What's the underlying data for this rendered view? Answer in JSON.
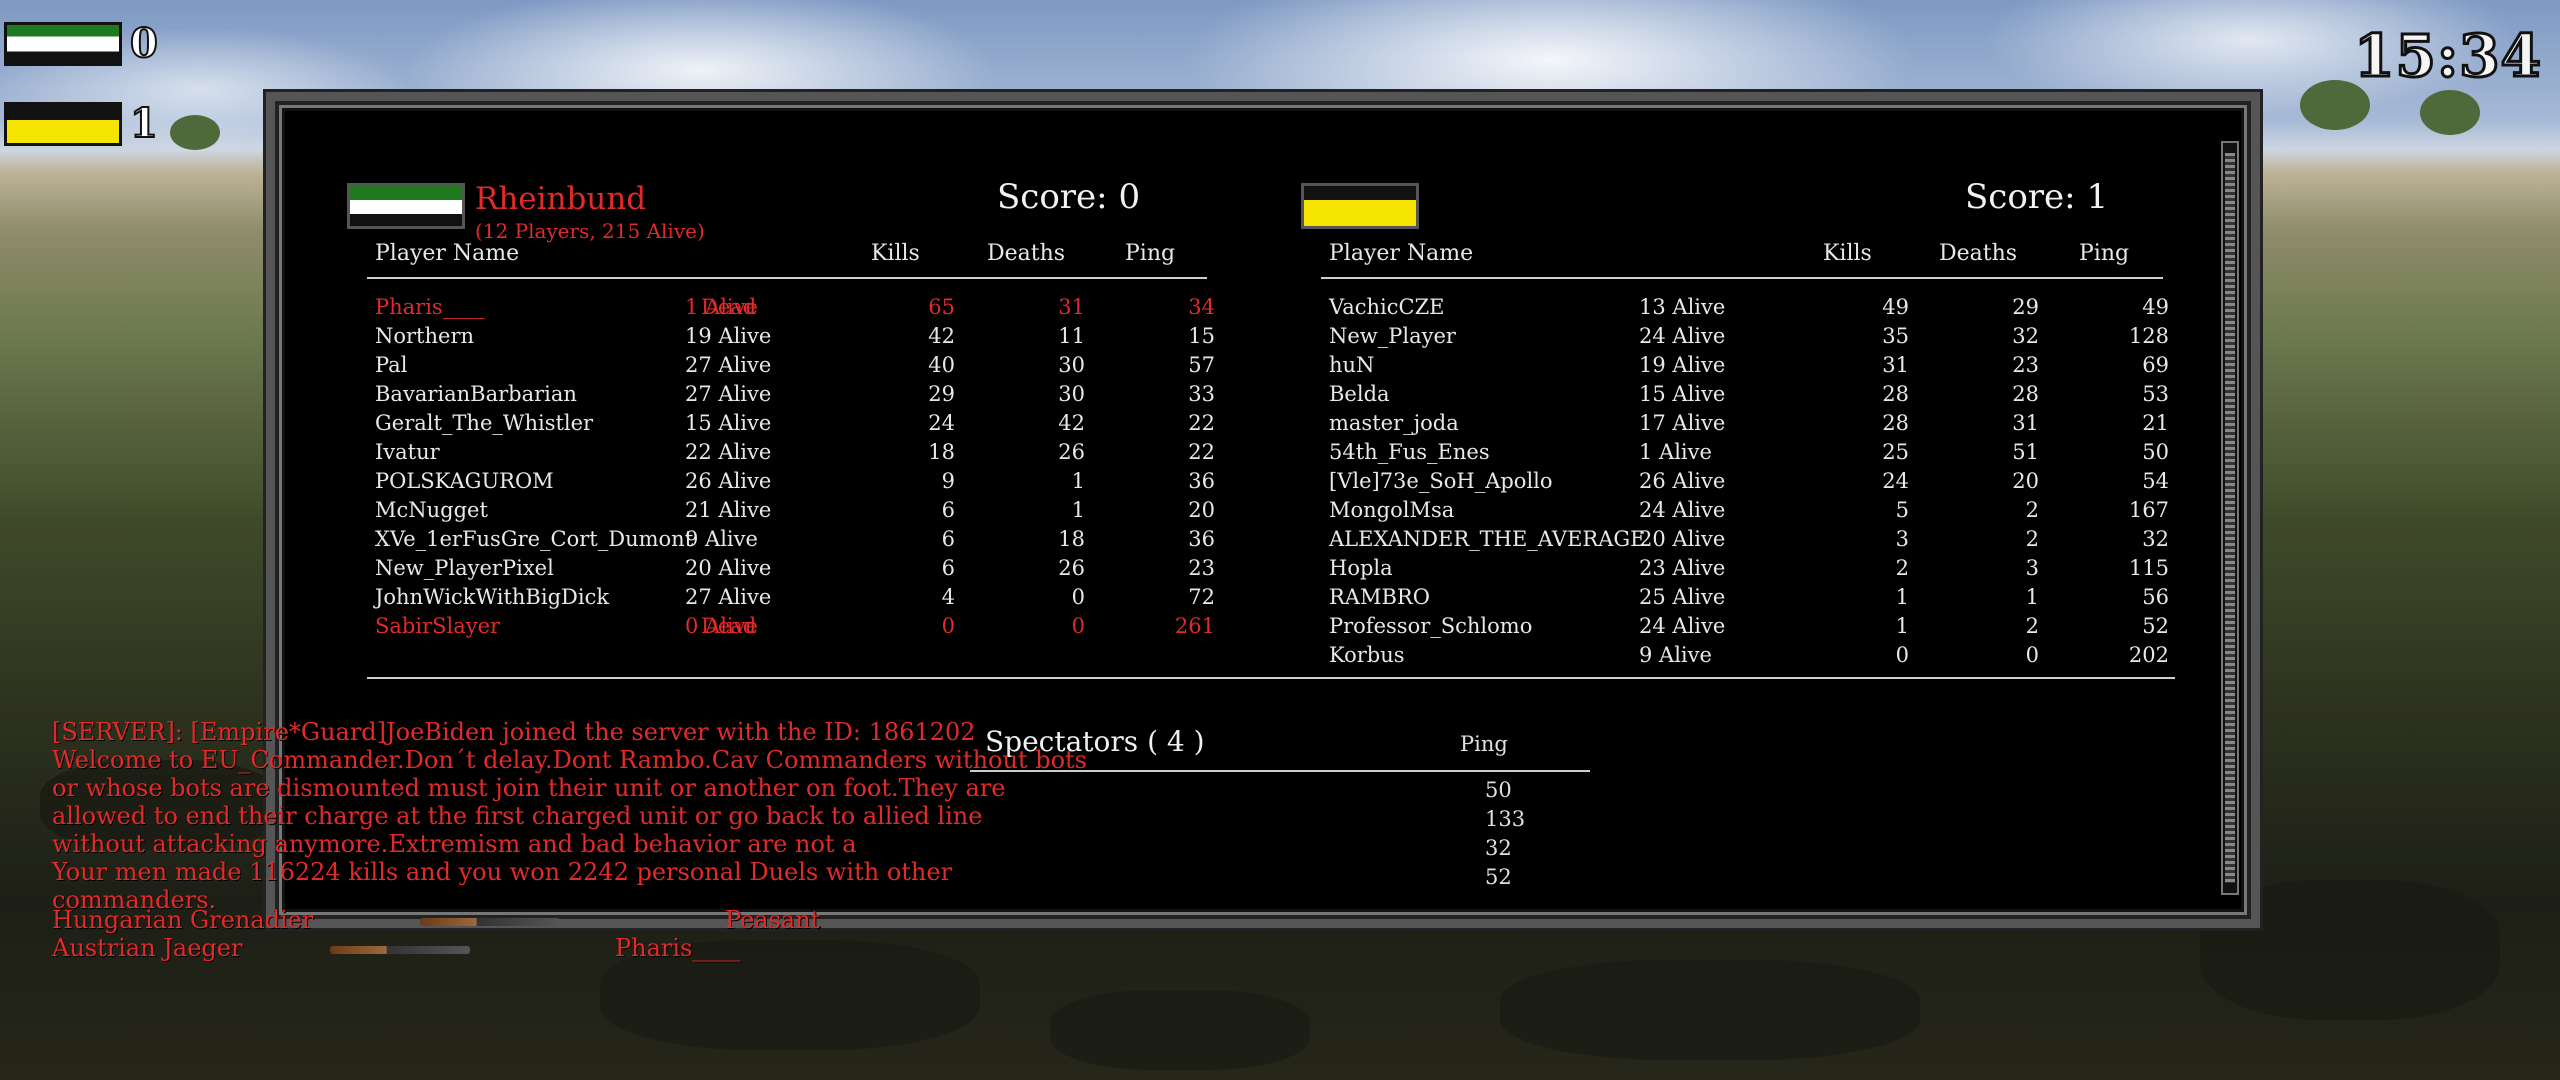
{
  "hud": {
    "team1_score": "0",
    "team2_score": "1",
    "clock": "15:34"
  },
  "colors": {
    "red_text": "#e12b2b",
    "team1_flag": [
      "#1f7a1f",
      "#ffffff",
      "#111111"
    ],
    "team2_flag": [
      "#111111",
      "#f5e400"
    ]
  },
  "left_team": {
    "name": "Rheinbund",
    "subtitle": "(12 Players,  215 Alive)",
    "score_label": "Score: 0",
    "headers": {
      "name": "Player Name",
      "kills": "Kills",
      "deaths": "Deaths",
      "ping": "Ping"
    },
    "players": [
      {
        "name": "Pharis____",
        "status": "1 Alive",
        "kills": "65",
        "deaths": "31",
        "ping": "34",
        "highlight": true,
        "status_overlay": "Dead"
      },
      {
        "name": "Northern",
        "status": "19 Alive",
        "kills": "42",
        "deaths": "11",
        "ping": "15"
      },
      {
        "name": "Pal",
        "status": "27 Alive",
        "kills": "40",
        "deaths": "30",
        "ping": "57"
      },
      {
        "name": "BavarianBarbarian",
        "status": "27 Alive",
        "kills": "29",
        "deaths": "30",
        "ping": "33"
      },
      {
        "name": "Geralt_The_Whistler",
        "status": "15 Alive",
        "kills": "24",
        "deaths": "42",
        "ping": "22"
      },
      {
        "name": "Ivatur",
        "status": "22 Alive",
        "kills": "18",
        "deaths": "26",
        "ping": "22"
      },
      {
        "name": "POLSKAGUROM",
        "status": "26 Alive",
        "kills": "9",
        "deaths": "1",
        "ping": "36"
      },
      {
        "name": "McNugget",
        "status": "21 Alive",
        "kills": "6",
        "deaths": "1",
        "ping": "20"
      },
      {
        "name": "XVe_1erFusGre_Cort_Dumont",
        "status": "9 Alive",
        "kills": "6",
        "deaths": "18",
        "ping": "36"
      },
      {
        "name": "New_PlayerPixel",
        "status": "20 Alive",
        "kills": "6",
        "deaths": "26",
        "ping": "23"
      },
      {
        "name": "JohnWickWithBigDick",
        "status": "27 Alive",
        "kills": "4",
        "deaths": "0",
        "ping": "72"
      },
      {
        "name": "SabirSlayer",
        "status": "0 Alive",
        "kills": "0",
        "deaths": "0",
        "ping": "261",
        "highlight": true,
        "status_overlay": "Dead"
      }
    ]
  },
  "right_team": {
    "score_label": "Score: 1",
    "headers": {
      "name": "Player Name",
      "kills": "Kills",
      "deaths": "Deaths",
      "ping": "Ping"
    },
    "players": [
      {
        "name": "VachicCZE",
        "status": "13 Alive",
        "kills": "49",
        "deaths": "29",
        "ping": "49"
      },
      {
        "name": "New_Player",
        "status": "24 Alive",
        "kills": "35",
        "deaths": "32",
        "ping": "128"
      },
      {
        "name": "huN",
        "status": "19 Alive",
        "kills": "31",
        "deaths": "23",
        "ping": "69"
      },
      {
        "name": "Belda",
        "status": "15 Alive",
        "kills": "28",
        "deaths": "28",
        "ping": "53"
      },
      {
        "name": "master_joda",
        "status": "17 Alive",
        "kills": "28",
        "deaths": "31",
        "ping": "21"
      },
      {
        "name": "54th_Fus_Enes",
        "status": "1 Alive",
        "kills": "25",
        "deaths": "51",
        "ping": "50"
      },
      {
        "name": "[Vle]73e_SoH_Apollo",
        "status": "26 Alive",
        "kills": "24",
        "deaths": "20",
        "ping": "54"
      },
      {
        "name": "MongolMsa",
        "status": "24 Alive",
        "kills": "5",
        "deaths": "2",
        "ping": "167"
      },
      {
        "name": "ALEXANDER_THE_AVERAGE",
        "status": "20 Alive",
        "kills": "3",
        "deaths": "2",
        "ping": "32"
      },
      {
        "name": "Hopla",
        "status": "23 Alive",
        "kills": "2",
        "deaths": "3",
        "ping": "115"
      },
      {
        "name": "RAMBRO",
        "status": "25 Alive",
        "kills": "1",
        "deaths": "1",
        "ping": "56"
      },
      {
        "name": "Professor_Schlomo",
        "status": "24 Alive",
        "kills": "1",
        "deaths": "2",
        "ping": "52"
      },
      {
        "name": "Korbus",
        "status": "9 Alive",
        "kills": "0",
        "deaths": "0",
        "ping": "202"
      }
    ]
  },
  "spectators": {
    "title": "Spectators ( 4 )",
    "ping_header": "Ping",
    "pings": [
      "50",
      "133",
      "32",
      "52"
    ]
  },
  "chat": [
    "[SERVER]: [Empire*Guard]JoeBiden joined the server with the ID: 1861202",
    "Welcome to EU_Commander.Don´t delay.Dont Rambo.Cav Commanders without bots",
    "or whose bots are dismounted must join their unit or another on foot.They are",
    "allowed to end their charge at the first charged unit or go back to allied line",
    "without attacking anymore.Extremism and bad behavior are not a",
    "Your men made 116224 kills and you won 2242 personal Duels with other",
    "commanders."
  ],
  "killfeed": [
    {
      "killer": "Hungarian Grenadier",
      "victim": "Peasant"
    },
    {
      "killer": "Austrian Jaeger",
      "victim": "Pharis____"
    }
  ]
}
